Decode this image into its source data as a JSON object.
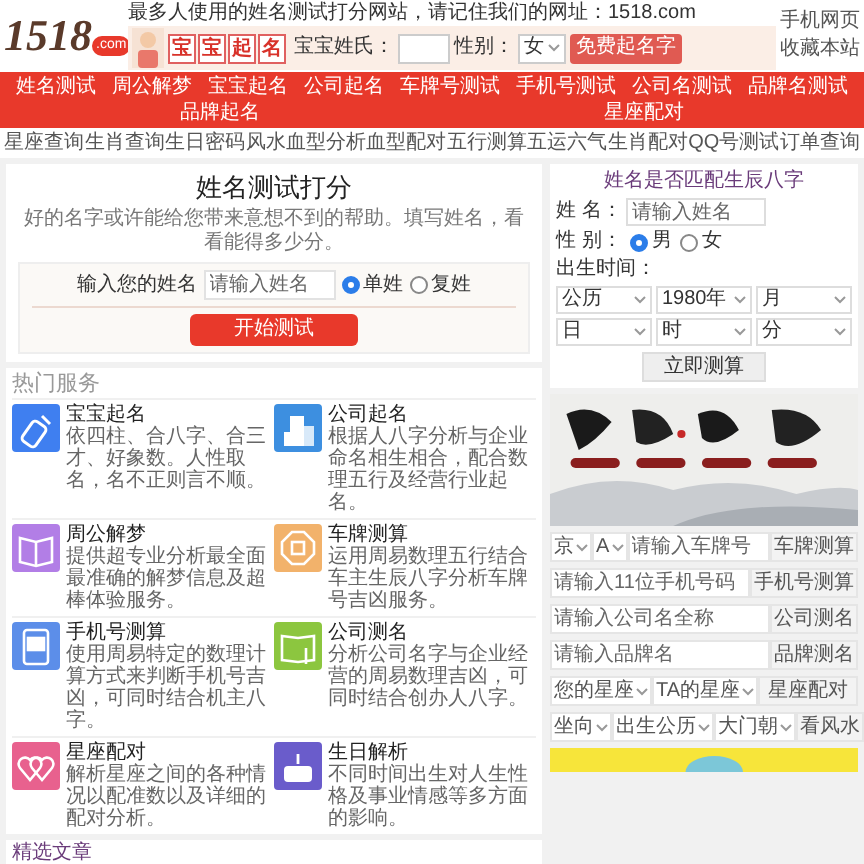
{
  "header": {
    "logo": "1518",
    "logo_suffix": ".com",
    "slogan": "最多人使用的姓名测试打分网站，请记住我们的网址：1518.com",
    "banner": {
      "tiles": [
        "宝",
        "宝",
        "起",
        "名"
      ],
      "surname_label": "宝宝姓氏：",
      "gender_label": "性别：",
      "gender_value": "女",
      "button": "免费起名字"
    },
    "links": [
      "手机网页",
      "收藏本站"
    ]
  },
  "nav": [
    "姓名测试",
    "周公解梦",
    "宝宝起名",
    "公司起名",
    "车牌号测试",
    "手机号测试",
    "公司名测试",
    "品牌名测试",
    "品牌起名",
    "星座配对"
  ],
  "subnav": [
    "星座查询",
    "生肖查询",
    "生日密码",
    "风水",
    "血型分析",
    "血型配对",
    "五行测算",
    "五运六气",
    "生肖配对",
    "QQ号测试",
    "订单查询"
  ],
  "name_test": {
    "title": "姓名测试打分",
    "description": "好的名字或许能给您带来意想不到的帮助。填写姓名，看看能得多少分。",
    "input_label": "输入您的姓名",
    "placeholder": "请输入姓名",
    "options": [
      {
        "label": "单姓",
        "selected": true
      },
      {
        "label": "复姓",
        "selected": false
      }
    ],
    "button": "开始测试"
  },
  "hot_services": {
    "title": "热门服务",
    "items": [
      {
        "kind": "bottle",
        "title": "宝宝起名",
        "description": "依四柱、合八字、合三才、好象数。人性取名，名不正则言不顺。"
      },
      {
        "kind": "building",
        "title": "公司起名",
        "description": "根据人八字分析与企业命名相生相合，配合数理五行及经营行业起名。"
      },
      {
        "kind": "book",
        "title": "周公解梦",
        "description": "提供超专业分析最全面最准确的解梦信息及超棒体验服务。"
      },
      {
        "kind": "bagua",
        "title": "车牌测算",
        "description": "运用周易数理五行结合车主生辰八字分析车牌号吉凶服务。"
      },
      {
        "kind": "phone",
        "title": "手机号测算",
        "description": "使用周易特定的数理计算方式来判断手机号吉凶，可同时结合机主八字。"
      },
      {
        "kind": "reading",
        "title": "公司测名",
        "description": "分析公司名字与企业经营的周易数理吉凶，可同时结合创办人八字。"
      },
      {
        "kind": "hearts",
        "title": "星座配对",
        "description": "解析星座之间的各种情况以配准数以及详细的配对分析。"
      },
      {
        "kind": "cake",
        "title": "生日解析",
        "description": "不同时间出生对人生性格及事业情感等多方面的影响。"
      }
    ]
  },
  "articles": {
    "title": "精选文章"
  },
  "bazi_match": {
    "title": "姓名是否匹配生辰八字",
    "name_label": "姓 名：",
    "placeholder": "请输入姓名",
    "gender_label": "性 别：",
    "genders": [
      {
        "label": "男",
        "selected": true
      },
      {
        "label": "女",
        "selected": false
      }
    ],
    "birth_label": "出生时间：",
    "selects": [
      "公历",
      "1980年",
      "月",
      "日",
      "时",
      "分"
    ],
    "button": "立即测算"
  },
  "quick_tools": [
    {
      "selects": [
        "京",
        "A"
      ],
      "placeholder": "请输入车牌号",
      "button": "车牌测算"
    },
    {
      "placeholder": "请输入11位手机号码",
      "button": "手机号测算"
    },
    {
      "placeholder": "请输入公司名全称",
      "button": "公司测名"
    },
    {
      "placeholder": "请输入品牌名",
      "button": "品牌测名"
    },
    {
      "selects": [
        "您的星座",
        "TA的星座"
      ],
      "button": "星座配对"
    },
    {
      "selects": [
        "坐向",
        "出生公历",
        "大门朝"
      ],
      "button": "看风水"
    }
  ]
}
